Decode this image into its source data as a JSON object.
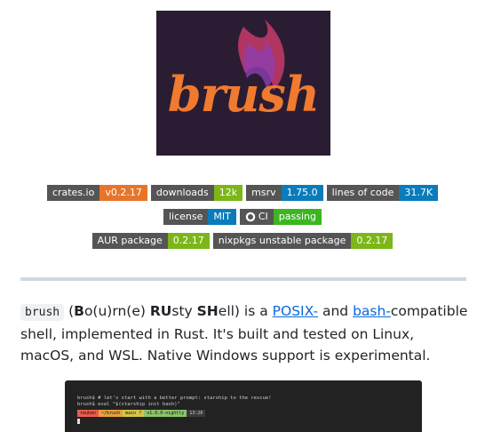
{
  "logo": {
    "text": "brush",
    "bg": "#2a1d33",
    "accent": "#f07a2f"
  },
  "badges": {
    "row1": [
      {
        "label": "crates.io",
        "value": "v0.2.17",
        "color": "#e6752a"
      },
      {
        "label": "downloads",
        "value": "12k",
        "color": "#7cb618"
      },
      {
        "label": "msrv",
        "value": "1.75.0",
        "color": "#0a7bbb"
      },
      {
        "label": "lines of code",
        "value": "31.7K",
        "color": "#0a7bbb"
      }
    ],
    "row2": [
      {
        "label": "license",
        "value": "MIT",
        "color": "#0a7bbb"
      },
      {
        "label": "CI",
        "value": "passing",
        "color": "#3cb620",
        "icon": "github-icon"
      }
    ],
    "row3": [
      {
        "label": "AUR package",
        "value": "0.2.17",
        "color": "#7cb618"
      },
      {
        "label": "nixpkgs unstable package",
        "value": "0.2.17",
        "color": "#7cb618"
      }
    ]
  },
  "intro": {
    "code": "brush",
    "p1": " (",
    "b1": "B",
    "p2": "o(u)rn(e) ",
    "b2": "RU",
    "p3": "sty ",
    "b3": "SH",
    "p4": "ell) is a ",
    "link1": "POSIX-",
    "p5": " and ",
    "link2": "bash-",
    "p6": "compatible shell, implemented in Rust. It's built and tested on Linux, macOS, and WSL. Native Windows support is experimental."
  },
  "terminal": {
    "line1": "brush$ # let's start with a better prompt: starship to the rescue!",
    "line2": "brush$ eval \"$(starship init bash)\"",
    "seg1": "reuben",
    "seg2": "~/brush",
    "seg3": "main ?",
    "seg4": "v1.0.0-nightly",
    "seg5": "13:26"
  }
}
